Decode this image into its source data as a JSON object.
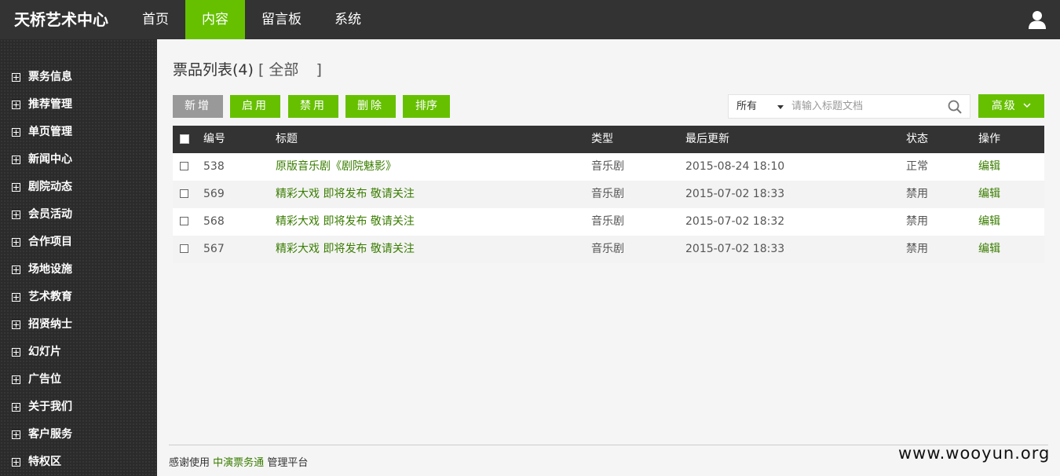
{
  "header": {
    "brand": "天桥艺术中心",
    "nav": [
      {
        "label": "首页",
        "active": false
      },
      {
        "label": "内容",
        "active": true
      },
      {
        "label": "留言板",
        "active": false
      },
      {
        "label": "系统",
        "active": false
      }
    ],
    "user_icon": "user-icon"
  },
  "sidebar": {
    "items": [
      {
        "label": "票务信息"
      },
      {
        "label": "推荐管理"
      },
      {
        "label": "单页管理"
      },
      {
        "label": "新闻中心"
      },
      {
        "label": "剧院动态"
      },
      {
        "label": "会员活动"
      },
      {
        "label": "合作项目"
      },
      {
        "label": "场地设施"
      },
      {
        "label": "艺术教育"
      },
      {
        "label": "招贤纳士"
      },
      {
        "label": "幻灯片"
      },
      {
        "label": "广告位"
      },
      {
        "label": "关于我们"
      },
      {
        "label": "客户服务"
      },
      {
        "label": "特权区"
      }
    ]
  },
  "main": {
    "title": "票品列表(4)",
    "filter_open": "[ 全部",
    "filter_close": "]",
    "toolbar": {
      "add": "新增",
      "enable": "启用",
      "disable": "禁用",
      "delete": "删除",
      "sort": "排序"
    },
    "search": {
      "scope": "所有",
      "placeholder": "请输入标题文档",
      "value": ""
    },
    "advanced": "高级"
  },
  "table": {
    "columns": {
      "id": "编号",
      "title": "标题",
      "type": "类型",
      "updated": "最后更新",
      "status": "状态",
      "action": "操作"
    },
    "rows": [
      {
        "id": "538",
        "title": "原版音乐剧《剧院魅影》",
        "type": "音乐剧",
        "updated": "2015-08-24 18:10",
        "status": "正常",
        "action": "编辑"
      },
      {
        "id": "569",
        "title": "精彩大戏 即将发布 敬请关注",
        "type": "音乐剧",
        "updated": "2015-07-02 18:33",
        "status": "禁用",
        "action": "编辑"
      },
      {
        "id": "568",
        "title": "精彩大戏 即将发布 敬请关注",
        "type": "音乐剧",
        "updated": "2015-07-02 18:32",
        "status": "禁用",
        "action": "编辑"
      },
      {
        "id": "567",
        "title": "精彩大戏 即将发布 敬请关注",
        "type": "音乐剧",
        "updated": "2015-07-02 18:33",
        "status": "禁用",
        "action": "编辑"
      }
    ]
  },
  "footer": {
    "prefix": "感谢使用",
    "product": "中演票务通",
    "suffix": "管理平台"
  },
  "watermark": "www.wooyun.org",
  "colors": {
    "accent": "#66c000",
    "topbar": "#333333",
    "sidebar": "#2b2b2b",
    "link": "#3a7d00"
  }
}
